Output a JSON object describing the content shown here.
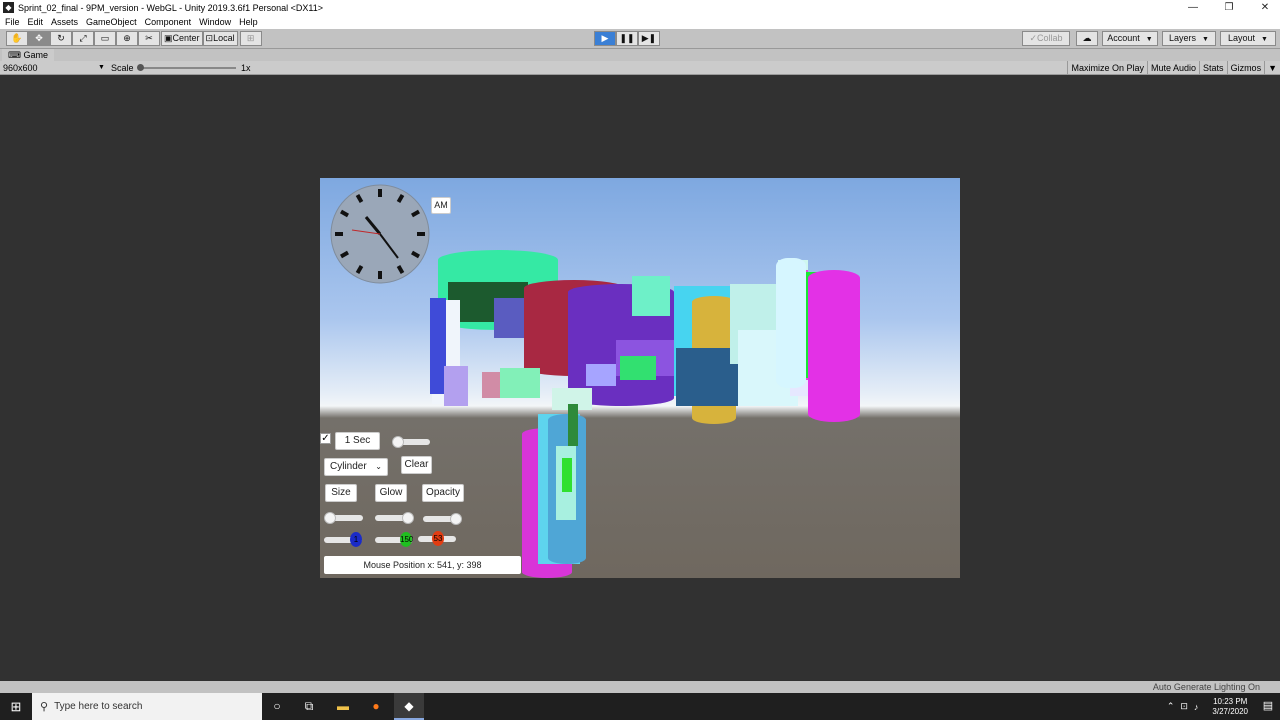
{
  "window": {
    "title": "Sprint_02_final - 9PM_version - WebGL - Unity 2019.3.6f1 Personal <DX11>",
    "controls": {
      "minimize": "—",
      "maximize": "❐",
      "close": "✕"
    }
  },
  "menu": {
    "items": [
      "File",
      "Edit",
      "Assets",
      "GameObject",
      "Component",
      "Window",
      "Help"
    ]
  },
  "toolbar": {
    "pivot_center": "Center",
    "pivot_local": "Local",
    "collab": "Collab",
    "account": "Account",
    "layers": "Layers",
    "layout": "Layout"
  },
  "game_view": {
    "tab": "Game",
    "resolution": "960x600",
    "scale_label": "Scale",
    "scale_value": "1x",
    "buttons": [
      "Maximize On Play",
      "Mute Audio",
      "Stats",
      "Gizmos"
    ]
  },
  "scene_ui": {
    "am_label": "AM",
    "interval_button": "1 Sec",
    "shape_select": "Cylinder",
    "clear_button": "Clear",
    "size_button": "Size",
    "glow_button": "Glow",
    "opacity_button": "Opacity",
    "color_labels": [
      "1",
      "150",
      "53"
    ],
    "colors": {
      "blue": "#1a2bc7",
      "green": "#1fbf1f",
      "red": "#e23c12"
    },
    "mouse_position": "Mouse Position x: 541, y: 398"
  },
  "status": {
    "lighting": "Auto Generate Lighting On"
  },
  "taskbar": {
    "search_placeholder": "Type here to search",
    "time": "10:23 PM",
    "date": "3/27/2020"
  }
}
